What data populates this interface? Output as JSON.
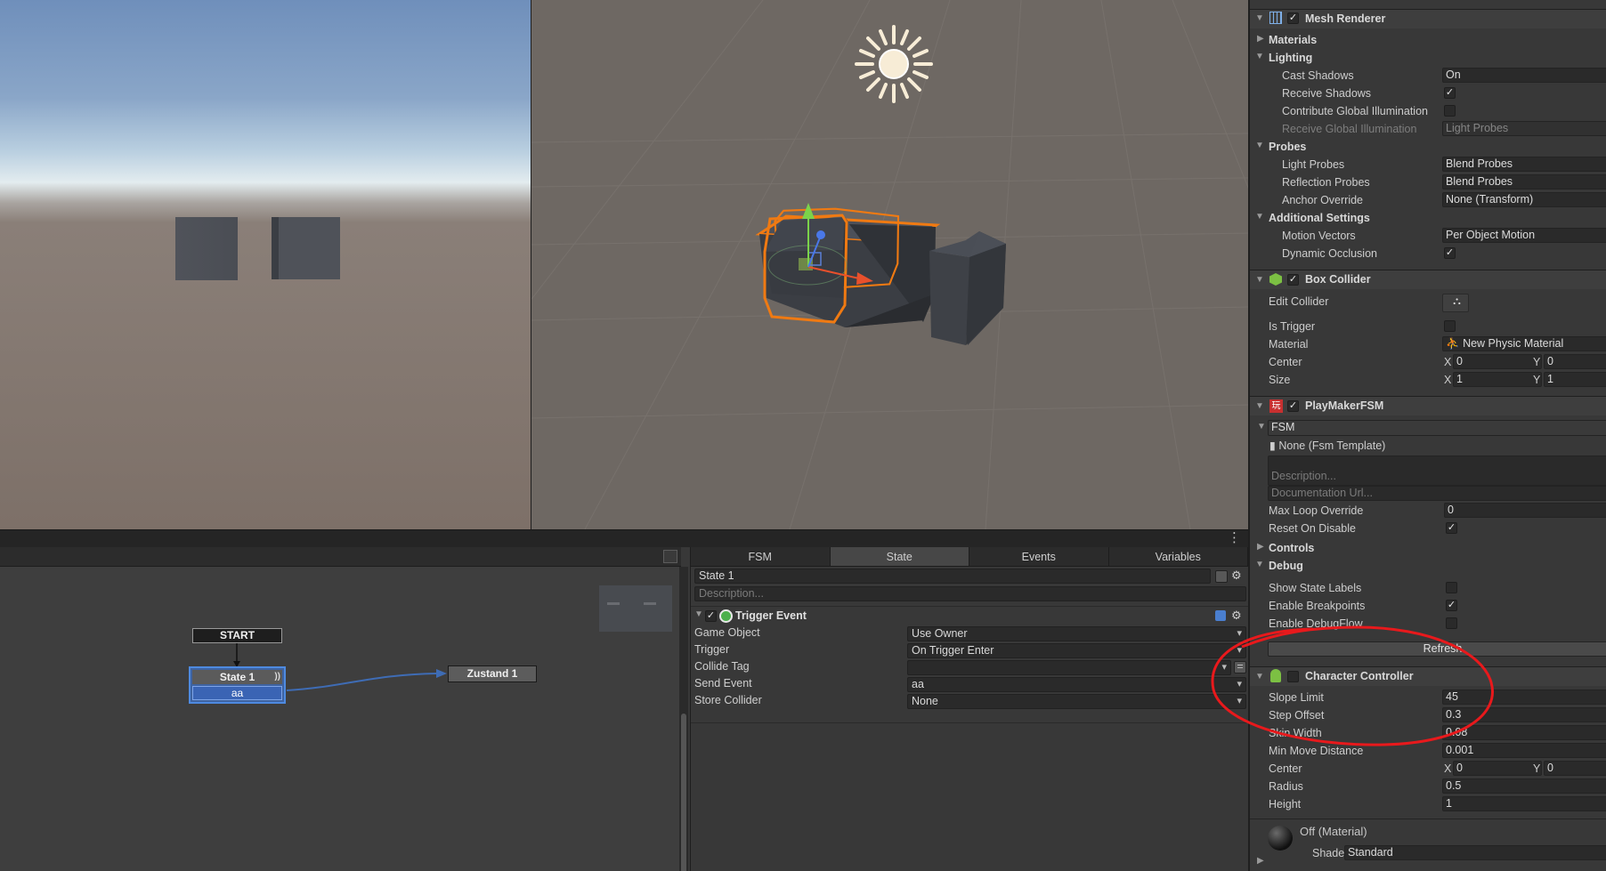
{
  "graph": {
    "start_label": "START",
    "state_node": {
      "title": "State 1",
      "tag": "))",
      "event": "aa"
    },
    "target_node": {
      "title": "Zustand 1"
    }
  },
  "fsm_editor": {
    "tabs": [
      "FSM",
      "State",
      "Events",
      "Variables"
    ],
    "active_tab": "State",
    "state_name": "State 1",
    "description_placeholder": "Description...",
    "action": {
      "title": "Trigger Event",
      "rows": [
        {
          "label": "Game Object",
          "value": "Use Owner"
        },
        {
          "label": "Trigger",
          "value": "On Trigger Enter"
        },
        {
          "label": "Collide Tag",
          "value": ""
        },
        {
          "label": "Send Event",
          "value": "aa"
        },
        {
          "label": "Store Collider",
          "value": "None"
        }
      ]
    }
  },
  "inspector": {
    "mesh_renderer": {
      "title": "Mesh Renderer",
      "materials": "Materials",
      "lighting": "Lighting",
      "cast_shadows": {
        "label": "Cast Shadows",
        "value": "On"
      },
      "receive_shadows": {
        "label": "Receive Shadows"
      },
      "contribute_gi": {
        "label": "Contribute Global Illumination"
      },
      "receive_gi": {
        "label": "Receive Global Illumination",
        "value": "Light Probes"
      },
      "probes": "Probes",
      "light_probes": {
        "label": "Light Probes",
        "value": "Blend Probes"
      },
      "reflection_probes": {
        "label": "Reflection Probes",
        "value": "Blend Probes"
      },
      "anchor_override": {
        "label": "Anchor Override",
        "value": "None (Transform)"
      },
      "additional_settings": "Additional Settings",
      "motion_vectors": {
        "label": "Motion Vectors",
        "value": "Per Object Motion"
      },
      "dynamic_occlusion": {
        "label": "Dynamic Occlusion"
      }
    },
    "box_collider": {
      "title": "Box Collider",
      "edit_collider": "Edit Collider",
      "is_trigger": "Is Trigger",
      "material": {
        "label": "Material",
        "value": "New Physic Material"
      },
      "center": {
        "label": "Center",
        "x": "0",
        "y": "0"
      },
      "size": {
        "label": "Size",
        "x": "1",
        "y": "1"
      }
    },
    "playmaker": {
      "title": "PlayMakerFSM",
      "fsm_name": "FSM",
      "template": "None (Fsm Template)",
      "description_placeholder": "Description...",
      "doc_url_placeholder": "Documentation Url...",
      "max_loop": {
        "label": "Max Loop Override",
        "value": "0"
      },
      "reset_on_disable": "Reset On Disable",
      "controls": "Controls",
      "debug": "Debug",
      "show_state_labels": "Show State Labels",
      "enable_breakpoints": "Enable Breakpoints",
      "enable_debugflow": "Enable DebugFlow",
      "refresh": "Refresh"
    },
    "character_controller": {
      "title": "Character Controller",
      "slope_limit": {
        "label": "Slope Limit",
        "value": "45"
      },
      "step_offset": {
        "label": "Step Offset",
        "value": "0.3"
      },
      "skin_width": {
        "label": "Skin Width",
        "value": "0.08"
      },
      "min_move": {
        "label": "Min Move Distance",
        "value": "0.001"
      },
      "center": {
        "label": "Center",
        "x": "0",
        "y": "0"
      },
      "radius": {
        "label": "Radius",
        "value": "0.5"
      },
      "height": {
        "label": "Height",
        "value": "1"
      }
    },
    "material": {
      "title": "Off (Material)",
      "shader_label": "Shader",
      "shader_value": "Standard"
    },
    "axis_x": "X",
    "axis_y": "Y"
  },
  "colors": {
    "annotation": "#e8191c",
    "selection": "#f07a12",
    "state_selected": "#4e8ae0"
  }
}
